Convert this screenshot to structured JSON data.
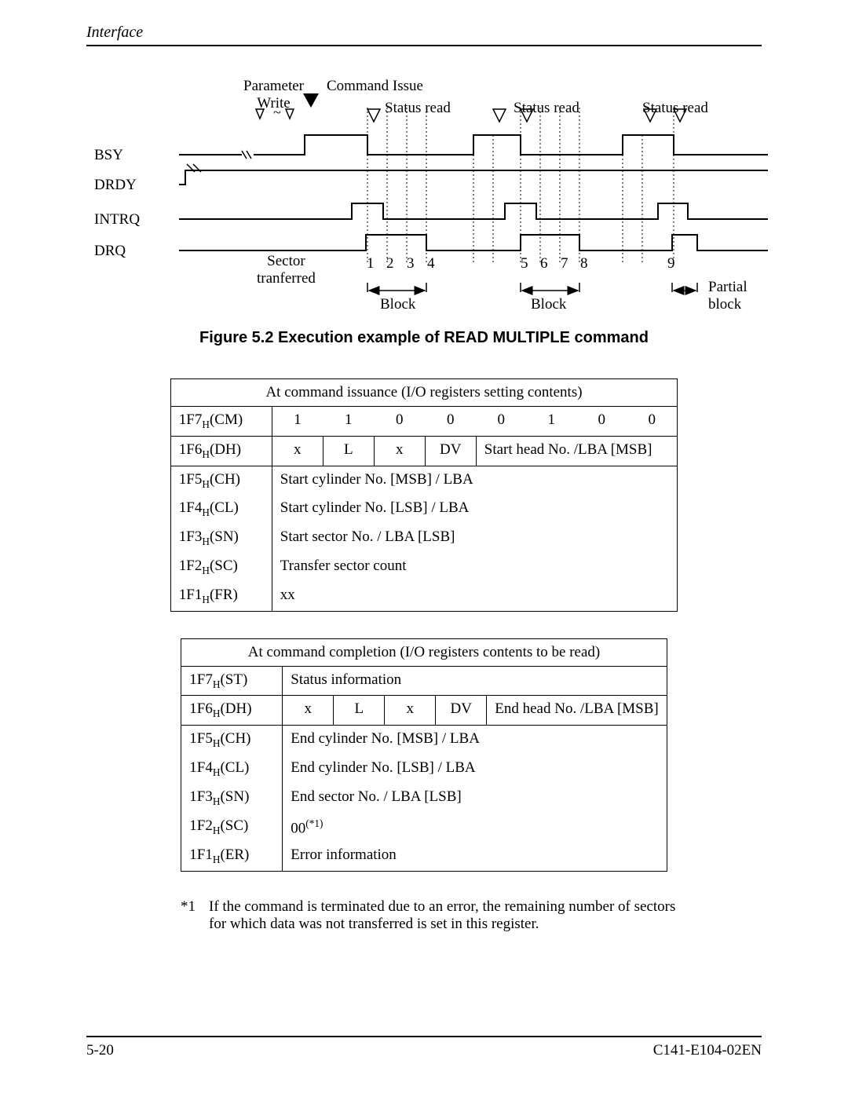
{
  "header": {
    "section": "Interface"
  },
  "figure": {
    "caption": "Figure 5.2  Execution example of READ MULTIPLE command",
    "top_labels": {
      "param_write": "Parameter\nWrite",
      "cmd_issue": "Command Issue",
      "status_read_1": "Status read",
      "status_read_2": "Status read",
      "status_read_3": "Status read"
    },
    "signals": [
      "BSY",
      "DRDY",
      "INTRQ",
      "DRQ"
    ],
    "bottom": {
      "sector_tranferred": "Sector\ntranferred",
      "nums": [
        "1",
        "2",
        "3",
        "4",
        "5",
        "6",
        "7",
        "8",
        "9"
      ],
      "block_a": "Block",
      "block_b": "Block",
      "partial": "Partial\nblock"
    }
  },
  "table_issue": {
    "title": "At command issuance (I/O registers setting contents)",
    "rows": {
      "cm": {
        "reg": "1F7",
        "name": "(CM)",
        "bits": [
          "1",
          "1",
          "0",
          "0",
          "0",
          "1",
          "0",
          "0"
        ]
      },
      "dh": {
        "reg": "1F6",
        "name": "(DH)",
        "bits": [
          "x",
          "L",
          "x",
          "DV"
        ],
        "rest": "Start head No. /LBA [MSB]"
      },
      "ch": {
        "reg": "1F5",
        "name": "(CH)",
        "val": "Start cylinder No. [MSB] / LBA"
      },
      "cl": {
        "reg": "1F4",
        "name": "(CL)",
        "val": "Start cylinder No. [LSB] / LBA"
      },
      "sn": {
        "reg": "1F3",
        "name": "(SN)",
        "val": "Start sector No. / LBA [LSB]"
      },
      "sc": {
        "reg": "1F2",
        "name": "(SC)",
        "val": "Transfer sector count"
      },
      "fr": {
        "reg": "1F1",
        "name": "(FR)",
        "val": "xx"
      }
    }
  },
  "table_complete": {
    "title": "At command completion (I/O registers contents to be read)",
    "rows": {
      "st": {
        "reg": "1F7",
        "name": "(ST)",
        "val": "Status information"
      },
      "dh": {
        "reg": "1F6",
        "name": "(DH)",
        "bits": [
          "x",
          "L",
          "x",
          "DV"
        ],
        "rest": "End head No. /LBA [MSB]"
      },
      "ch": {
        "reg": "1F5",
        "name": "(CH)",
        "val": "End cylinder No. [MSB] / LBA"
      },
      "cl": {
        "reg": "1F4",
        "name": "(CL)",
        "val": "End cylinder No. [LSB] / LBA"
      },
      "sn": {
        "reg": "1F3",
        "name": "(SN)",
        "val": "End sector No. / LBA [LSB]"
      },
      "sc": {
        "reg": "1F2",
        "name": "(SC)",
        "val_base": "00",
        "val_sup": "(*1)"
      },
      "er": {
        "reg": "1F1",
        "name": "(ER)",
        "val": "Error information"
      }
    }
  },
  "footnote": {
    "mark": "*1",
    "text": "If the command is terminated due to an error, the remaining number of sectors for which data was not transferred is set in this register."
  },
  "footer": {
    "page": "5-20",
    "doc": "C141-E104-02EN"
  }
}
